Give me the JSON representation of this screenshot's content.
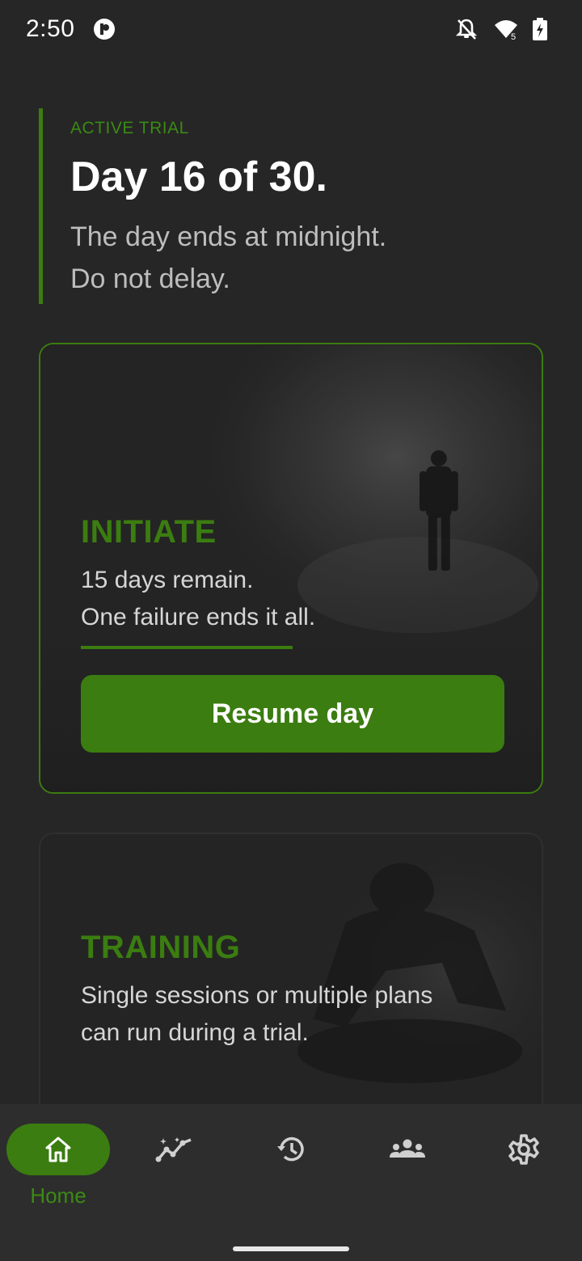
{
  "status_bar": {
    "time": "2:50",
    "icons": [
      "app-notification-icon",
      "notifications-off-icon",
      "wifi-icon",
      "battery-charging-icon"
    ],
    "wifi_badge": "5"
  },
  "trial": {
    "eyebrow": "ACTIVE TRIAL",
    "title": "Day 16 of 30.",
    "subtitle_line1": "The day ends at midnight.",
    "subtitle_line2": "Do not delay."
  },
  "initiate_card": {
    "title": "INITIATE",
    "line1": "15 days remain.",
    "line2": "One failure ends it all.",
    "progress": 0.5,
    "button_label": "Resume day"
  },
  "training_card": {
    "title": "TRAINING",
    "line1": "Single sessions or multiple plans",
    "line2": "can run during a trial."
  },
  "bottom_nav": {
    "items": [
      {
        "icon": "home-icon",
        "label": "Home",
        "active": true
      },
      {
        "icon": "insights-icon",
        "label": "",
        "active": false
      },
      {
        "icon": "history-icon",
        "label": "",
        "active": false
      },
      {
        "icon": "group-icon",
        "label": "",
        "active": false
      },
      {
        "icon": "settings-icon",
        "label": "",
        "active": false
      }
    ]
  },
  "colors": {
    "background": "#262626",
    "accent": "#3b7d10",
    "nav_background": "#2d2d2d"
  }
}
